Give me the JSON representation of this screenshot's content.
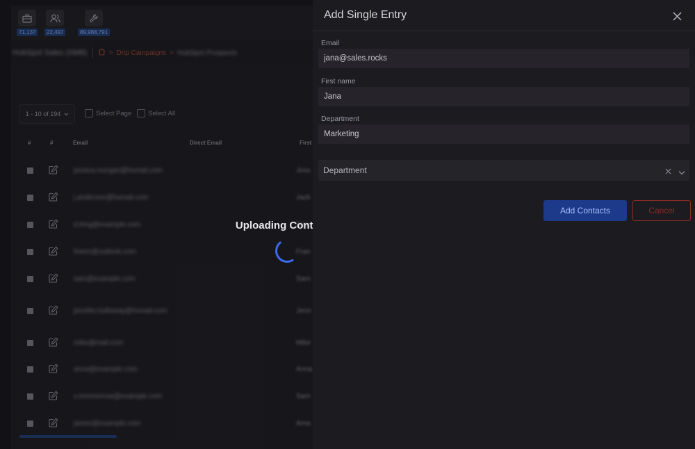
{
  "stats": [
    {
      "icon": "briefcase-icon",
      "value": "71,137"
    },
    {
      "icon": "users-icon",
      "value": "22,497"
    },
    {
      "icon": "wrench-icon",
      "value": "89,988,791"
    }
  ],
  "breadcrumb": {
    "account": "HubSpot Sales (SMB)",
    "home_icon": "home-icon",
    "link": "Drip Campaigns",
    "current": "HubSpot Prospects"
  },
  "table": {
    "pager": "1 - 10 of 194",
    "select_page": "Select Page",
    "select_all": "Select All",
    "headers": [
      "#",
      "#",
      "Email",
      "Direct Email",
      "First"
    ],
    "rows": [
      {
        "email": "jessica.morgan@hsmail.com",
        "first": "Jess"
      },
      {
        "email": "j.anderson@hsmail.com",
        "first": "Jack"
      },
      {
        "email": "d.king@example.com",
        "first": "Dan"
      },
      {
        "email": "freem@outlook.com",
        "first": "Fran"
      },
      {
        "email": "sam@example.com",
        "first": "Sam"
      },
      {
        "email": "jennifer.holloway@hsmail.com",
        "first": "Jenn"
      },
      {
        "email": "mike@mail.com",
        "first": "Mike"
      },
      {
        "email": "anna@example.com",
        "first": "Anna"
      },
      {
        "email": "s.tommorrow@example.com",
        "first": "Sam"
      },
      {
        "email": "james@example.com",
        "first": "Ama"
      }
    ]
  },
  "overlay": {
    "text": "Uploading Contacts..."
  },
  "panel": {
    "title": "Add Single Entry",
    "email_label": "Email",
    "email_value": "jana@sales.rocks",
    "first_name_label": "First name",
    "first_name_value": "Jana",
    "department_label": "Department",
    "department_value": "Marketing",
    "select_value": "Department",
    "add_button": "Add Contacts",
    "cancel_button": "Cancel"
  },
  "colors": {
    "accent": "#1d3a8a",
    "danger": "#8a2e24",
    "link": "#a0402e"
  }
}
